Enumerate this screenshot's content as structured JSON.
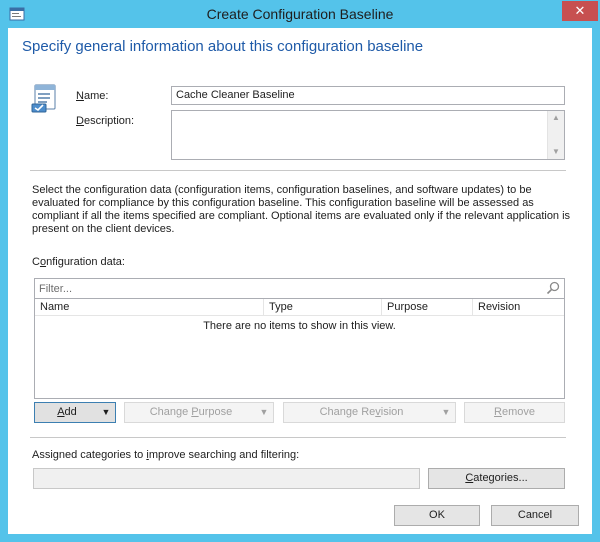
{
  "window": {
    "title": "Create Configuration Baseline",
    "close_glyph": "✕",
    "icon": "app-icon",
    "accent_color": "#54c3ea",
    "close_color": "#c75050"
  },
  "heading": "Specify general information about this configuration baseline",
  "name_field": {
    "label_underlined": "N",
    "label_rest": "ame:",
    "value": "Cache Cleaner Baseline"
  },
  "description_field": {
    "label_underlined": "D",
    "label_rest": "escription:",
    "value": "",
    "scroll_up": "▲",
    "scroll_down": "▼"
  },
  "info_text": "Select the configuration data (configuration items, configuration baselines, and software updates) to be evaluated for compliance by this configuration baseline. This configuration baseline will be assessed as compliant if all the items specified are compliant. Optional items are evaluated only if the relevant application is present on  the client devices.",
  "config_data": {
    "label_pre": "C",
    "label_underlined": "o",
    "label_rest": "nfiguration data:",
    "filter_placeholder": "Filter...",
    "columns": [
      "Name",
      "Type",
      "Purpose",
      "Revision"
    ],
    "empty_message": "There are no items to show in this view."
  },
  "actions": {
    "add": {
      "underlined": "A",
      "rest": "dd",
      "arrow": "▼"
    },
    "change_purpose": {
      "pre": "Change ",
      "underlined": "P",
      "rest": "urpose",
      "arrow": "▼"
    },
    "change_revision": {
      "pre": "Change Re",
      "underlined": "v",
      "rest": "ision",
      "arrow": "▼"
    },
    "remove": {
      "underlined": "R",
      "rest": "emove"
    }
  },
  "categories": {
    "label_pre": "Assigned categories to ",
    "label_underlined": "i",
    "label_rest": "mprove searching and filtering:",
    "value": "",
    "button_underlined": "C",
    "button_rest": "ategories..."
  },
  "footer": {
    "ok": "OK",
    "cancel": "Cancel"
  }
}
